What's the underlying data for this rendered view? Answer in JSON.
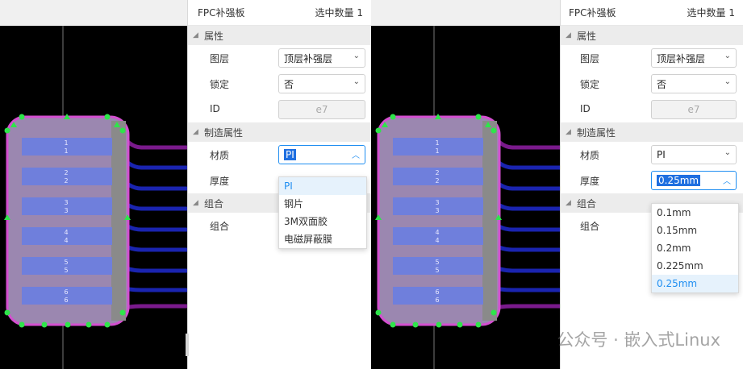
{
  "colors": {
    "board_fill": "#9b87b0",
    "board_outline": "#d44fd0",
    "pad_fill": "#6f7fdc",
    "trace_purple": "#7a1a8c",
    "trace_blue": "#1a24b0",
    "marker_green": "#2ee54a",
    "accent_blue": "#1f8ef1"
  },
  "pad_labels": [
    "1",
    "2",
    "3",
    "4",
    "5",
    "6"
  ],
  "left": {
    "panel": {
      "title": "FPC补强板",
      "count_label": "选中数量",
      "count_value": "1",
      "sections": {
        "props": "属性",
        "mfg": "制造属性",
        "group": "组合"
      },
      "fields": {
        "layer_label": "图层",
        "layer_value": "顶层补强层",
        "lock_label": "锁定",
        "lock_value": "否",
        "id_label": "ID",
        "id_value": "e7",
        "material_label": "材质",
        "material_value": "PI",
        "thickness_label": "厚度",
        "group_label": "组合"
      },
      "dropdown_options": [
        "PI",
        "钢片",
        "3M双面胶",
        "电磁屏蔽膜"
      ],
      "dropdown_selected": "PI"
    }
  },
  "right": {
    "panel": {
      "title": "FPC补强板",
      "count_label": "选中数量",
      "count_value": "1",
      "sections": {
        "props": "属性",
        "mfg": "制造属性",
        "group": "组合"
      },
      "fields": {
        "layer_label": "图层",
        "layer_value": "顶层补强层",
        "lock_label": "锁定",
        "lock_value": "否",
        "id_label": "ID",
        "id_value": "e7",
        "material_label": "材质",
        "material_value": "PI",
        "thickness_label": "厚度",
        "thickness_value": "0.25mm",
        "group_label": "组合"
      },
      "dropdown_options": [
        "0.1mm",
        "0.15mm",
        "0.2mm",
        "0.225mm",
        "0.25mm"
      ],
      "dropdown_selected": "0.25mm"
    }
  },
  "watermark": "公众号 · 嵌入式Linux"
}
